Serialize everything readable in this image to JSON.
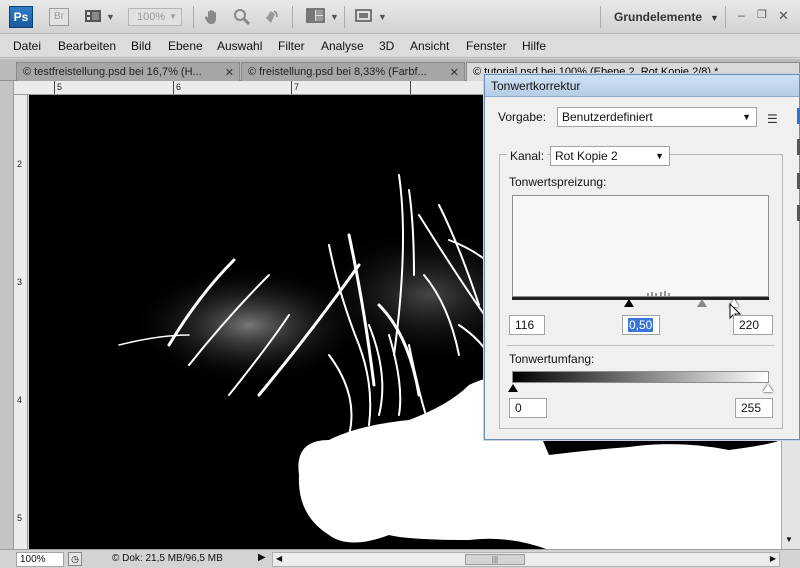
{
  "appbar": {
    "ps_logo": "Ps",
    "br_logo": "Br",
    "zoom_value": "100%",
    "workspace": "Grundelemente",
    "icons": [
      "film-icon",
      "hand-icon",
      "zoom-icon",
      "rotate-icon",
      "arrange-icon",
      "screen-mode-icon"
    ]
  },
  "menu": [
    "Datei",
    "Bearbeiten",
    "Bild",
    "Ebene",
    "Auswahl",
    "Filter",
    "Analyse",
    "3D",
    "Ansicht",
    "Fenster",
    "Hilfe"
  ],
  "tabs": [
    {
      "label": "© testfreistellung.psd bei 16,7% (H..."
    },
    {
      "label": "© freistellung.psd bei 8,33% (Farbf..."
    },
    {
      "label": "© tutorial.psd bei 100% (Ebene 2, Rot Kopie 2/8) *"
    }
  ],
  "ruler": {
    "top": [
      "5",
      "6",
      "7"
    ],
    "left": [
      "2",
      "3",
      "4",
      "5"
    ]
  },
  "status": {
    "zoom": "100%",
    "doc_info": "© Dok: 21,5 MB/96,5 MB"
  },
  "dialog": {
    "title": "Tonwertkorrektur",
    "preset_label": "Vorgabe:",
    "preset_value": "Benutzerdefiniert",
    "channel_label": "Kanal:",
    "channel_value": "Rot Kopie 2",
    "input_levels_label": "Tonwertspreizung:",
    "input_black": "116",
    "input_gamma": "0,50",
    "input_white": "220",
    "output_levels_label": "Tonwertumfang:",
    "output_black": "0",
    "output_white": "255"
  },
  "colors": {
    "ps_blue": "#1b5a9c",
    "selection": "#3875d7",
    "dialog_border": "#6b8bb0"
  }
}
